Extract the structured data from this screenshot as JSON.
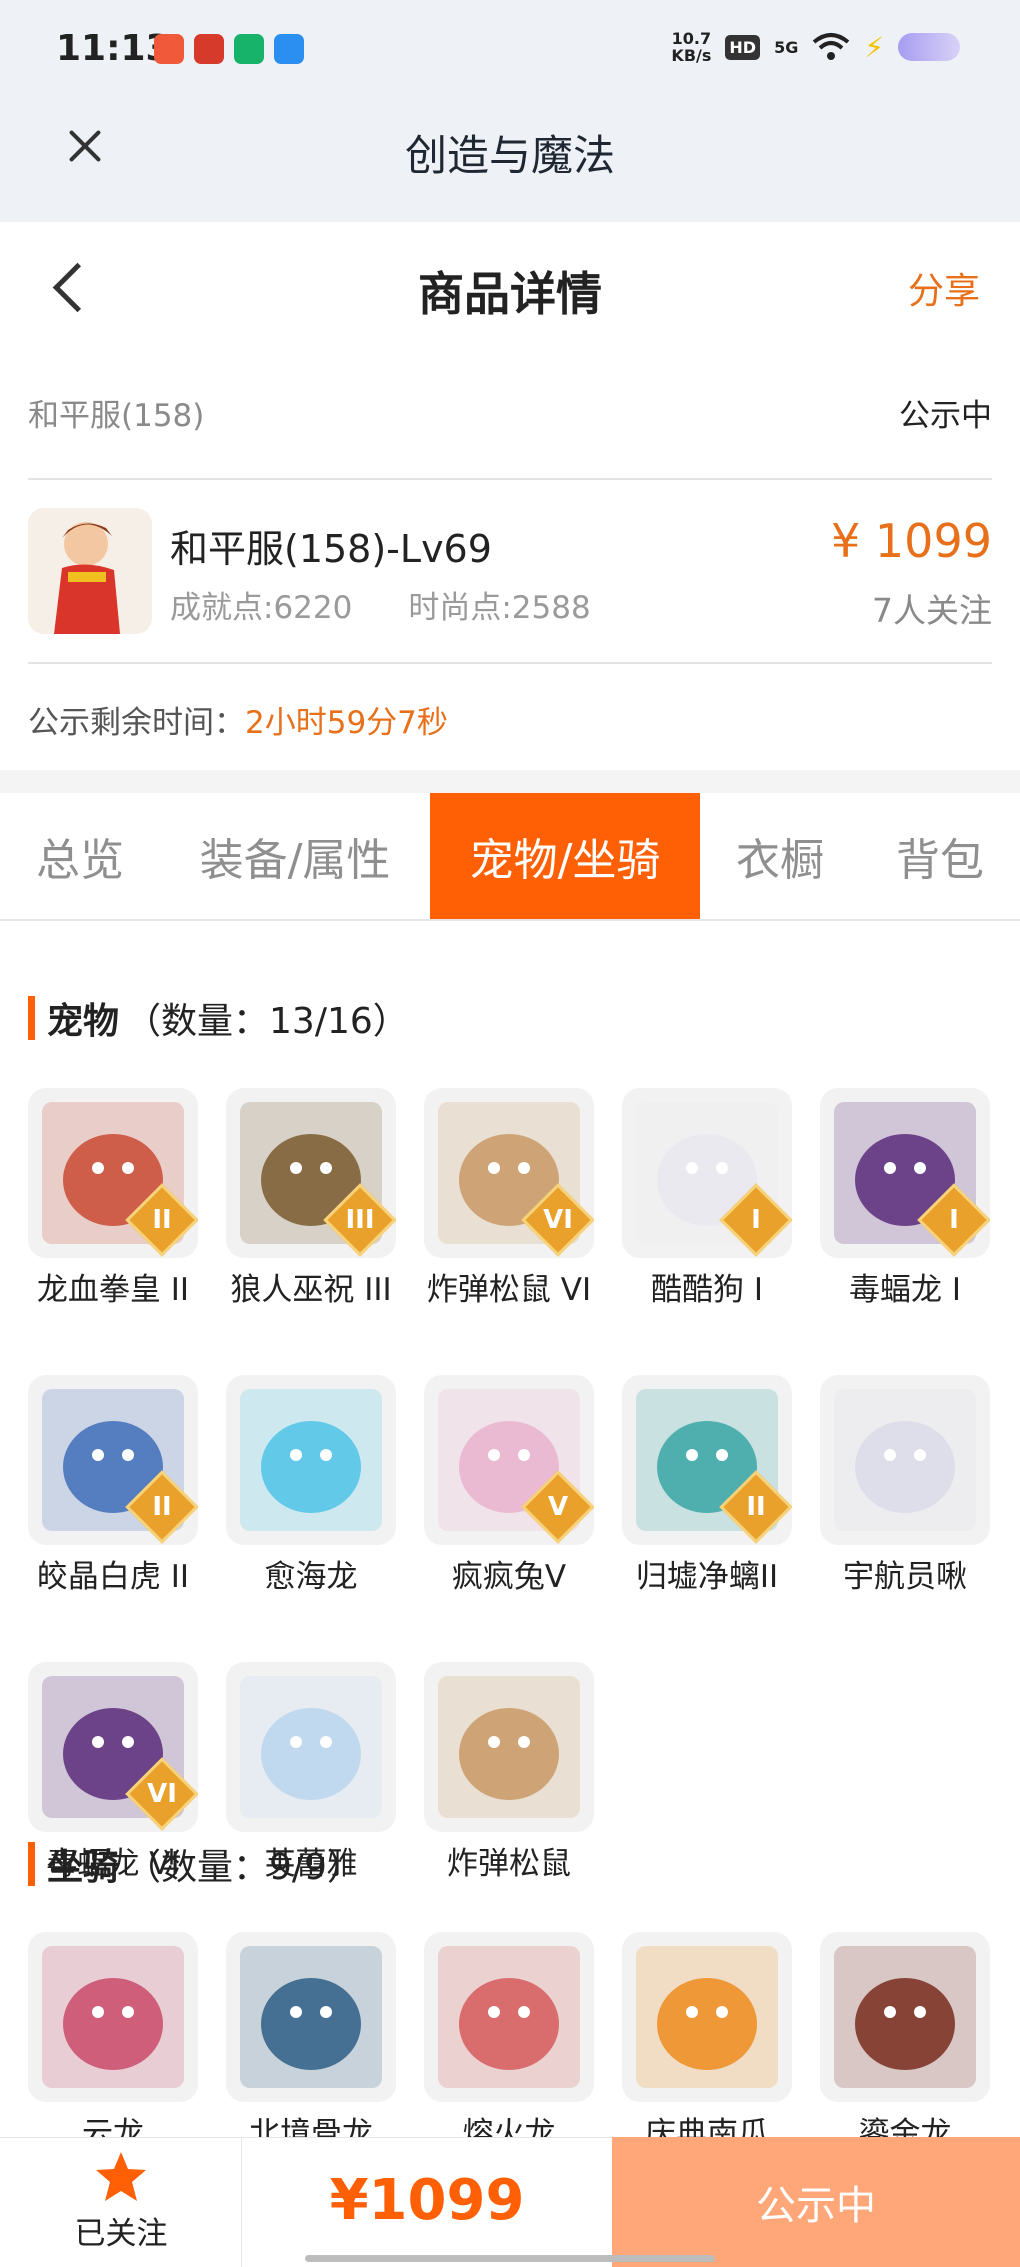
{
  "status_bar": {
    "time": "11:13",
    "speed_value": "10.7",
    "speed_unit": "KB/s",
    "hd": "HD",
    "network": "5G"
  },
  "webview": {
    "title": "创造与魔法"
  },
  "header": {
    "title": "商品详情",
    "share": "分享"
  },
  "listing": {
    "server": "和平服(158)",
    "status": "公示中",
    "character_title": "和平服(158)-Lv69",
    "achievement": "成就点:6220",
    "fashion": "时尚点:2588",
    "price": "¥ 1099",
    "followers": "7人关注",
    "remaining_label": "公示剩余时间：",
    "remaining_value": "2小时59分7秒"
  },
  "tabs": [
    {
      "label": "总览",
      "active": false
    },
    {
      "label": "装备/属性",
      "active": false
    },
    {
      "label": "宠物/坐骑",
      "active": true
    },
    {
      "label": "衣橱",
      "active": false
    },
    {
      "label": "背包",
      "active": false
    }
  ],
  "pets_section": {
    "title": "宠物",
    "count": "（数量：13/16）",
    "items": [
      {
        "name": "龙血拳皇 II",
        "rank": "II",
        "color": "#c94a33"
      },
      {
        "name": "狼人巫祝 III",
        "rank": "III",
        "color": "#7a5a2e"
      },
      {
        "name": "炸弹松鼠 VI",
        "rank": "VI",
        "color": "#c99a66"
      },
      {
        "name": "酷酷狗 I",
        "rank": "I",
        "color": "#e8e8ee"
      },
      {
        "name": "毒蝠龙 I",
        "rank": "I",
        "color": "#5b2b7a"
      },
      {
        "name": "皎晶白虎 II",
        "rank": "II",
        "color": "#3f6fb8"
      },
      {
        "name": "愈海龙",
        "rank": "",
        "color": "#4fc3e8"
      },
      {
        "name": "疯疯兔V",
        "rank": "V",
        "color": "#e9b3cf"
      },
      {
        "name": "归墟净螭II",
        "rank": "II",
        "color": "#3aa6a6"
      },
      {
        "name": "宇航员啾",
        "rank": "",
        "color": "#d9dbe8"
      },
      {
        "name": "毒蝠龙 VI",
        "rank": "VI",
        "color": "#5b2b7a"
      },
      {
        "name": "芙蕾雅",
        "rank": "",
        "color": "#b9d6ef"
      },
      {
        "name": "炸弹松鼠",
        "rank": "",
        "color": "#c99a66"
      }
    ]
  },
  "mounts_section": {
    "title": "坐骑",
    "count": "（数量：9/9）",
    "items": [
      {
        "name": "云龙",
        "color": "#c94a6a"
      },
      {
        "name": "北境骨龙",
        "color": "#2f5f86"
      },
      {
        "name": "熔火龙",
        "color": "#d65a5a"
      },
      {
        "name": "庆典南瓜",
        "color": "#ef8c1e"
      },
      {
        "name": "鎏金龙",
        "color": "#7a2c1e"
      }
    ]
  },
  "bottom": {
    "follow_label": "已关注",
    "price": "¥1099",
    "action": "公示中"
  },
  "colors": {
    "accent": "#ff6006",
    "price": "#e8701a",
    "action_bg": "#ffa778"
  }
}
